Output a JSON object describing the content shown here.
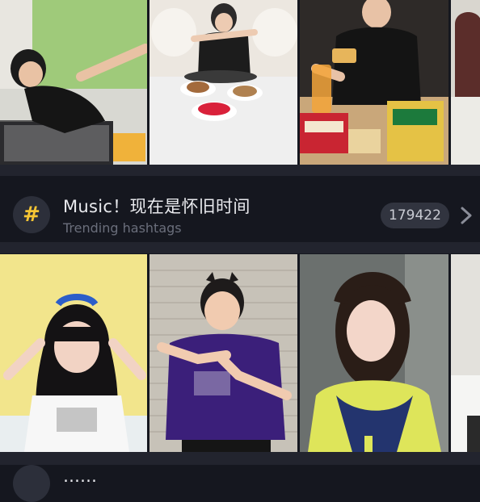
{
  "hashtag": {
    "icon": "hash-icon",
    "title": "Music！现在是怀旧时间",
    "subtitle": "Trending hashtags",
    "count": "179422"
  },
  "next_hashtag": {
    "title": "……"
  },
  "colors": {
    "background": "#15171f",
    "separator": "#22242e",
    "hash_accent": "#f6c534",
    "pill": "#31343f"
  },
  "top_videos": [
    {
      "name": "video-thumb-dancer-living-room"
    },
    {
      "name": "video-thumb-boy-on-sofa-with-food"
    },
    {
      "name": "video-thumb-boy-with-phone-and-snacks"
    },
    {
      "name": "video-thumb-partial-chair"
    }
  ],
  "mid_videos": [
    {
      "name": "video-thumb-girl-yellow-wall"
    },
    {
      "name": "video-thumb-boy-purple-shirt-brick-wall"
    },
    {
      "name": "video-thumb-girl-yellow-blouse"
    },
    {
      "name": "video-thumb-partial-right"
    }
  ]
}
